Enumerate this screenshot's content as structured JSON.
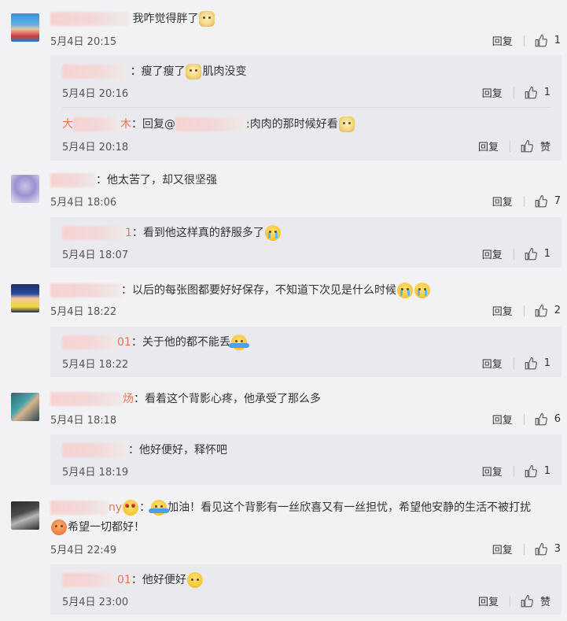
{
  "labels": {
    "reply": "回复",
    "zan": "赞"
  },
  "comments": [
    {
      "name_suffix": "",
      "text": "我咋觉得胖了",
      "time": "5月4日 20:15",
      "likes": "1",
      "replies": [
        {
          "name_suffix": "",
          "text": "：瘦了瘦了",
          "text2": "肌肉没变",
          "time": "5月4日 20:16",
          "likes": "1"
        },
        {
          "name_prefix": "大",
          "name_suffix": "木",
          "text": "：回复@",
          "text2": ":肉肉的那时候好看",
          "time": "5月4日 20:18",
          "likes": "赞"
        }
      ]
    },
    {
      "name_suffix": "",
      "text": "：他太苦了，却又很坚强",
      "time": "5月4日 18:06",
      "likes": "7",
      "replies": [
        {
          "name_suffix": "1",
          "text": "：看到他这样真的舒服多了",
          "time": "5月4日 18:07",
          "likes": "1"
        }
      ]
    },
    {
      "name_suffix": "",
      "text": "：以后的每张图都要好好保存，不知道下次见是什么时候",
      "time": "5月4日 18:22",
      "likes": "2",
      "replies": [
        {
          "name_suffix": "01",
          "text": "：关于他的都不能丢",
          "time": "5月4日 18:22",
          "likes": "1"
        }
      ]
    },
    {
      "name_suffix": "炀",
      "text": "：看着这个背影心疼，他承受了那么多",
      "time": "5月4日 18:18",
      "likes": "6",
      "replies": [
        {
          "name_suffix": "",
          "text": "：他好便好，释怀吧",
          "time": "5月4日 18:19",
          "likes": "1"
        }
      ]
    },
    {
      "name_suffix": "ny",
      "text": "：",
      "text2": "加油！看见这个背影有一丝欣喜又有一丝担忧，希望他安静的生活不被打扰",
      "text3": "希望一切都好！",
      "time": "5月4日 22:49",
      "likes": "3",
      "replies": [
        {
          "name_suffix": "01",
          "text": "：他好便好",
          "time": "5月4日 23:00",
          "likes": "赞"
        }
      ]
    }
  ]
}
